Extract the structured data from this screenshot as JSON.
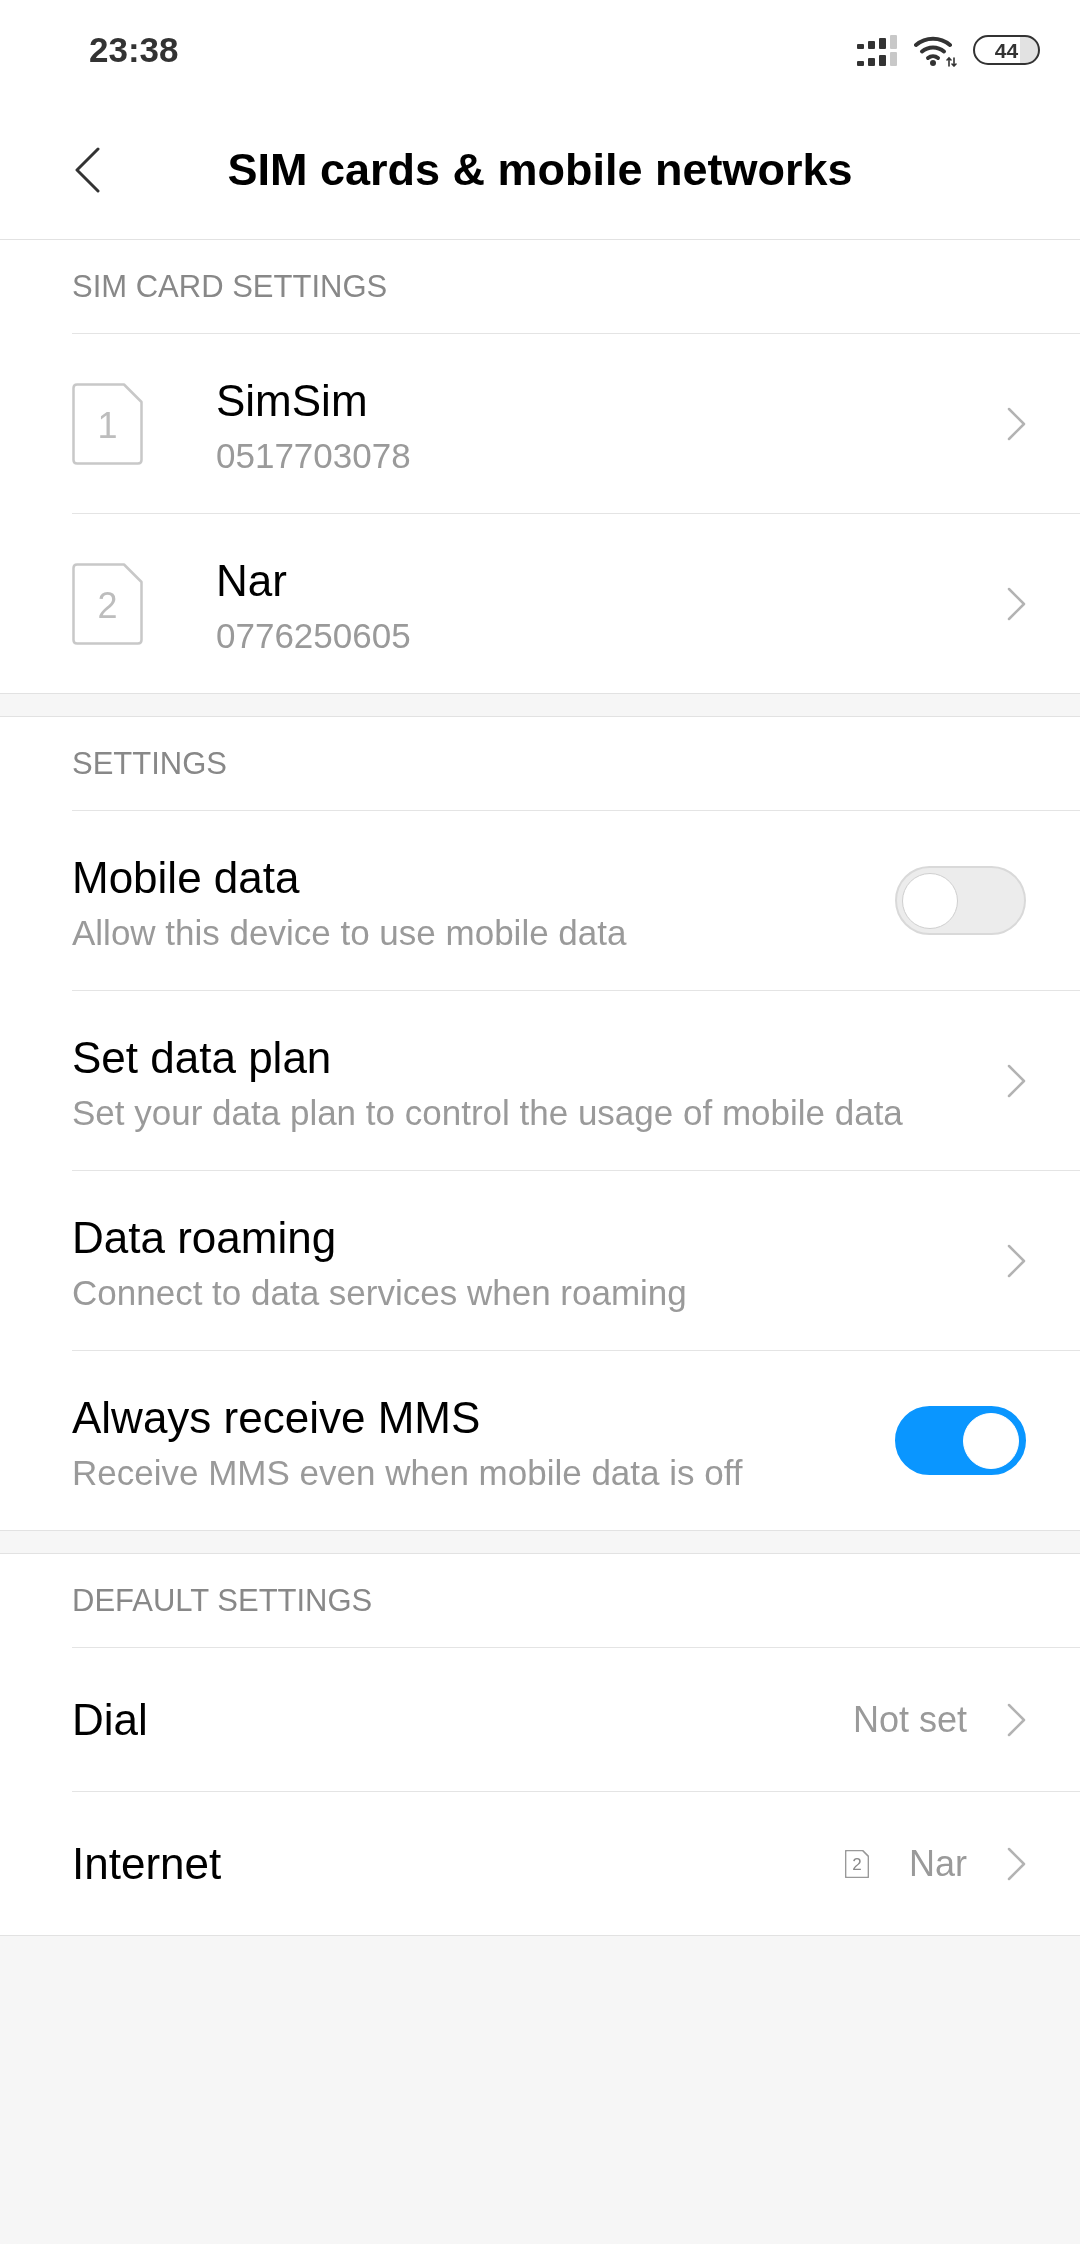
{
  "status_bar": {
    "time": "23:38",
    "battery": "44"
  },
  "header": {
    "title": "SIM cards & mobile networks"
  },
  "sections": [
    {
      "title": "SIM CARD SETTINGS",
      "items": [
        {
          "kind": "sim",
          "slot": "1",
          "name": "SimSim",
          "number": "0517703078"
        },
        {
          "kind": "sim",
          "slot": "2",
          "name": "Nar",
          "number": "0776250605"
        }
      ]
    },
    {
      "title": "SETTINGS",
      "items": [
        {
          "kind": "switch",
          "title": "Mobile data",
          "subtitle": "Allow this device to use mobile data",
          "on": false
        },
        {
          "kind": "link",
          "title": "Set data plan",
          "subtitle": "Set your data plan to control the usage of mobile data"
        },
        {
          "kind": "link",
          "title": "Data roaming",
          "subtitle": "Connect to data services when roaming"
        },
        {
          "kind": "switch",
          "title": "Always receive MMS",
          "subtitle": "Receive MMS even when mobile data is off",
          "on": true
        }
      ]
    },
    {
      "title": "DEFAULT SETTINGS",
      "items": [
        {
          "kind": "value",
          "title": "Dial",
          "value": "Not set"
        },
        {
          "kind": "value",
          "title": "Internet",
          "sim_slot": "2",
          "value": "Nar"
        }
      ]
    }
  ]
}
